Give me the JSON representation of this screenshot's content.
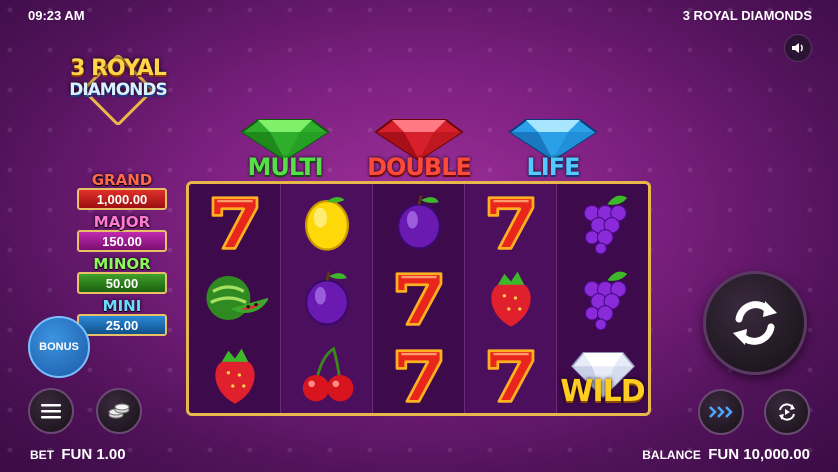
{
  "status_bar": {
    "time": "09:23 AM",
    "game_title": "3 ROYAL DIAMONDS"
  },
  "logo": {
    "line1": "3 ROYAL",
    "line2": "DIAMONDS"
  },
  "jackpots": [
    {
      "name": "GRAND",
      "value": "1,000.00",
      "color": "#e0302a"
    },
    {
      "name": "MAJOR",
      "value": "150.00",
      "color": "#c02ab0"
    },
    {
      "name": "MINOR",
      "value": "50.00",
      "color": "#3ea02a"
    },
    {
      "name": "MINI",
      "value": "25.00",
      "color": "#2a8ad8"
    }
  ],
  "bonus_button": {
    "label": "BONUS"
  },
  "gem_features": [
    {
      "label": "MULTI",
      "gem_color": "#3cc83a"
    },
    {
      "label": "DOUBLE",
      "gem_color": "#e8303a"
    },
    {
      "label": "LIFE",
      "gem_color": "#3ab4f0"
    }
  ],
  "reels": [
    [
      "seven",
      "watermelon",
      "strawberry"
    ],
    [
      "lemon",
      "plum",
      "cherry"
    ],
    [
      "plum",
      "seven",
      "seven"
    ],
    [
      "seven",
      "strawberry",
      "seven"
    ],
    [
      "grapes",
      "grapes",
      "wild-diamond"
    ]
  ],
  "wild_label": "WILD",
  "footer": {
    "bet_label": "BET",
    "bet_value": "FUN 1.00",
    "balance_label": "BALANCE",
    "balance_value": "FUN 10,000.00"
  },
  "colors": {
    "frame_gold": "#e8b84a",
    "background": "#7a1f7e"
  }
}
